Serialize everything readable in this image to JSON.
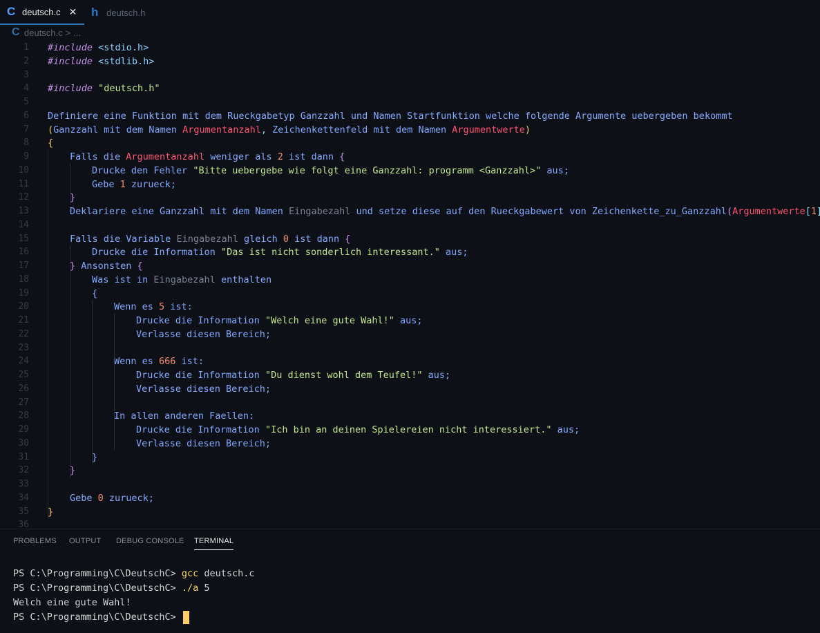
{
  "tabs": [
    {
      "icon": "C",
      "name": "deutsch.c",
      "close": "✕"
    },
    {
      "icon": "h",
      "name": "deutsch.h"
    }
  ],
  "breadcrumb": {
    "icon": "C",
    "file": "deutsch.c",
    "separator": ">",
    "rest": "..."
  },
  "editor": {
    "lines": [
      {
        "n": "1",
        "indent": 0,
        "tokens": [
          [
            "#include",
            "kw"
          ],
          [
            " <stdio.h>",
            "inc"
          ]
        ]
      },
      {
        "n": "2",
        "indent": 0,
        "tokens": [
          [
            "#include",
            "kw"
          ],
          [
            " <stdlib.h>",
            "inc"
          ]
        ]
      },
      {
        "n": "3",
        "indent": 0,
        "tokens": []
      },
      {
        "n": "4",
        "indent": 0,
        "tokens": [
          [
            "#include",
            "kw"
          ],
          [
            " \"deutsch.h\"",
            "str"
          ]
        ]
      },
      {
        "n": "5",
        "indent": 0,
        "tokens": []
      },
      {
        "n": "6",
        "indent": 0,
        "tokens": [
          [
            "Definiere eine Funktion mit dem Rueckgabetyp Ganzzahl und Namen Startfunktion welche folgende Argumente uebergeben bekommt",
            "txt"
          ]
        ]
      },
      {
        "n": "7",
        "indent": 0,
        "tokens": [
          [
            "(",
            "p1"
          ],
          [
            "Ganzzahl mit dem Namen ",
            "txt"
          ],
          [
            "Argumentanzahl",
            "red"
          ],
          [
            ", ",
            "pun"
          ],
          [
            "Zeichenkettenfeld mit dem Namen ",
            "txt"
          ],
          [
            "Argumentwerte",
            "red"
          ],
          [
            ")",
            "p1"
          ]
        ]
      },
      {
        "n": "8",
        "indent": 0,
        "tokens": [
          [
            "{",
            "p1"
          ]
        ]
      },
      {
        "n": "9",
        "indent": 1,
        "tokens": [
          [
            "Falls die ",
            "txt"
          ],
          [
            "Argumentanzahl",
            "red"
          ],
          [
            " weniger als ",
            "txt"
          ],
          [
            "2",
            "num"
          ],
          [
            " ist dann ",
            "txt"
          ],
          [
            "{",
            "p2"
          ]
        ]
      },
      {
        "n": "10",
        "indent": 2,
        "tokens": [
          [
            "Drucke den Fehler ",
            "txt"
          ],
          [
            "\"Bitte uebergebe wie folgt eine Ganzzahl: programm <Ganzzahl>\"",
            "str"
          ],
          [
            " aus;",
            "txt"
          ]
        ]
      },
      {
        "n": "11",
        "indent": 2,
        "tokens": [
          [
            "Gebe ",
            "txt"
          ],
          [
            "1",
            "num"
          ],
          [
            " zurueck;",
            "txt"
          ]
        ]
      },
      {
        "n": "12",
        "indent": 1,
        "tokens": [
          [
            "}",
            "p2"
          ]
        ]
      },
      {
        "n": "13",
        "indent": 1,
        "tokens": [
          [
            "Deklariere eine Ganzzahl mit dem Namen ",
            "txt"
          ],
          [
            "Eingabezahl",
            "dim"
          ],
          [
            " und setze diese auf den Rueckgabewert von Zeichenkette_zu_Ganzzahl",
            "txt"
          ],
          [
            "(",
            "p2"
          ],
          [
            "Argumentwerte",
            "red"
          ],
          [
            "[",
            "p3"
          ],
          [
            "1",
            "num"
          ],
          [
            "]",
            "p3"
          ],
          [
            ")",
            "p2"
          ],
          [
            ";",
            "txt"
          ]
        ]
      },
      {
        "n": "14",
        "indent": 0,
        "tokens": []
      },
      {
        "n": "15",
        "indent": 1,
        "tokens": [
          [
            "Falls die Variable ",
            "txt"
          ],
          [
            "Eingabezahl",
            "dim"
          ],
          [
            " gleich ",
            "txt"
          ],
          [
            "0",
            "num"
          ],
          [
            " ist dann ",
            "txt"
          ],
          [
            "{",
            "p2"
          ]
        ]
      },
      {
        "n": "16",
        "indent": 2,
        "tokens": [
          [
            "Drucke die Information ",
            "txt"
          ],
          [
            "\"Das ist nicht sonderlich interessant.\"",
            "str"
          ],
          [
            " aus;",
            "txt"
          ]
        ]
      },
      {
        "n": "17",
        "indent": 1,
        "tokens": [
          [
            "}",
            "p2"
          ],
          [
            " Ansonsten ",
            "txt"
          ],
          [
            "{",
            "p2"
          ]
        ]
      },
      {
        "n": "18",
        "indent": 2,
        "tokens": [
          [
            "Was ist in ",
            "txt"
          ],
          [
            "Eingabezahl",
            "dim"
          ],
          [
            " enthalten",
            "txt"
          ]
        ]
      },
      {
        "n": "19",
        "indent": 2,
        "tokens": [
          [
            "{",
            "txt"
          ]
        ]
      },
      {
        "n": "20",
        "indent": 3,
        "tokens": [
          [
            "Wenn es ",
            "txt"
          ],
          [
            "5",
            "num"
          ],
          [
            " ist:",
            "txt"
          ]
        ]
      },
      {
        "n": "21",
        "indent": 4,
        "tokens": [
          [
            "Drucke die Information ",
            "txt"
          ],
          [
            "\"Welch eine gute Wahl!\"",
            "str"
          ],
          [
            " aus;",
            "txt"
          ]
        ]
      },
      {
        "n": "22",
        "indent": 4,
        "tokens": [
          [
            "Verlasse diesen Bereich;",
            "txt"
          ]
        ]
      },
      {
        "n": "23",
        "indent": 0,
        "tokens": []
      },
      {
        "n": "24",
        "indent": 3,
        "tokens": [
          [
            "Wenn es ",
            "txt"
          ],
          [
            "666",
            "num"
          ],
          [
            " ist:",
            "txt"
          ]
        ]
      },
      {
        "n": "25",
        "indent": 4,
        "tokens": [
          [
            "Drucke die Information ",
            "txt"
          ],
          [
            "\"Du dienst wohl dem Teufel!\"",
            "str"
          ],
          [
            " aus;",
            "txt"
          ]
        ]
      },
      {
        "n": "26",
        "indent": 4,
        "tokens": [
          [
            "Verlasse diesen Bereich;",
            "txt"
          ]
        ]
      },
      {
        "n": "27",
        "indent": 0,
        "tokens": []
      },
      {
        "n": "28",
        "indent": 3,
        "tokens": [
          [
            "In allen anderen Faellen:",
            "txt"
          ]
        ]
      },
      {
        "n": "29",
        "indent": 4,
        "tokens": [
          [
            "Drucke die Information ",
            "txt"
          ],
          [
            "\"Ich bin an deinen Spielereien nicht interessiert.\"",
            "str"
          ],
          [
            " aus;",
            "txt"
          ]
        ]
      },
      {
        "n": "30",
        "indent": 4,
        "tokens": [
          [
            "Verlasse diesen Bereich;",
            "txt"
          ]
        ]
      },
      {
        "n": "31",
        "indent": 2,
        "tokens": [
          [
            "}",
            "txt"
          ]
        ]
      },
      {
        "n": "32",
        "indent": 1,
        "tokens": [
          [
            "}",
            "p2"
          ]
        ]
      },
      {
        "n": "33",
        "indent": 0,
        "tokens": []
      },
      {
        "n": "34",
        "indent": 1,
        "tokens": [
          [
            "Gebe ",
            "txt"
          ],
          [
            "0",
            "num"
          ],
          [
            " zurueck;",
            "txt"
          ]
        ]
      },
      {
        "n": "35",
        "indent": 0,
        "tokens": [
          [
            "}",
            "p1"
          ]
        ]
      },
      {
        "n": "36",
        "indent": 0,
        "tokens": []
      }
    ]
  },
  "panel": {
    "tabs": [
      "PROBLEMS",
      "OUTPUT",
      "DEBUG CONSOLE",
      "TERMINAL"
    ],
    "active_tab": "TERMINAL",
    "terminal": [
      {
        "prompt": "PS C:\\Programming\\C\\DeutschC> ",
        "cmd": "gcc",
        "args": " deutsch.c"
      },
      {
        "prompt": "PS C:\\Programming\\C\\DeutschC> ",
        "cmd": "./a",
        "args": " 5"
      },
      {
        "output": "Welch eine gute Wahl!"
      },
      {
        "prompt": "PS C:\\Programming\\C\\DeutschC> ",
        "cursor": true
      }
    ]
  },
  "colors": {
    "background": "#0d1017",
    "keyword": "#c792ea",
    "string": "#c3e88d",
    "text": "#82aaff",
    "parameter": "#ff5370",
    "number": "#f78c6c",
    "cursor": "#ffcc66"
  }
}
